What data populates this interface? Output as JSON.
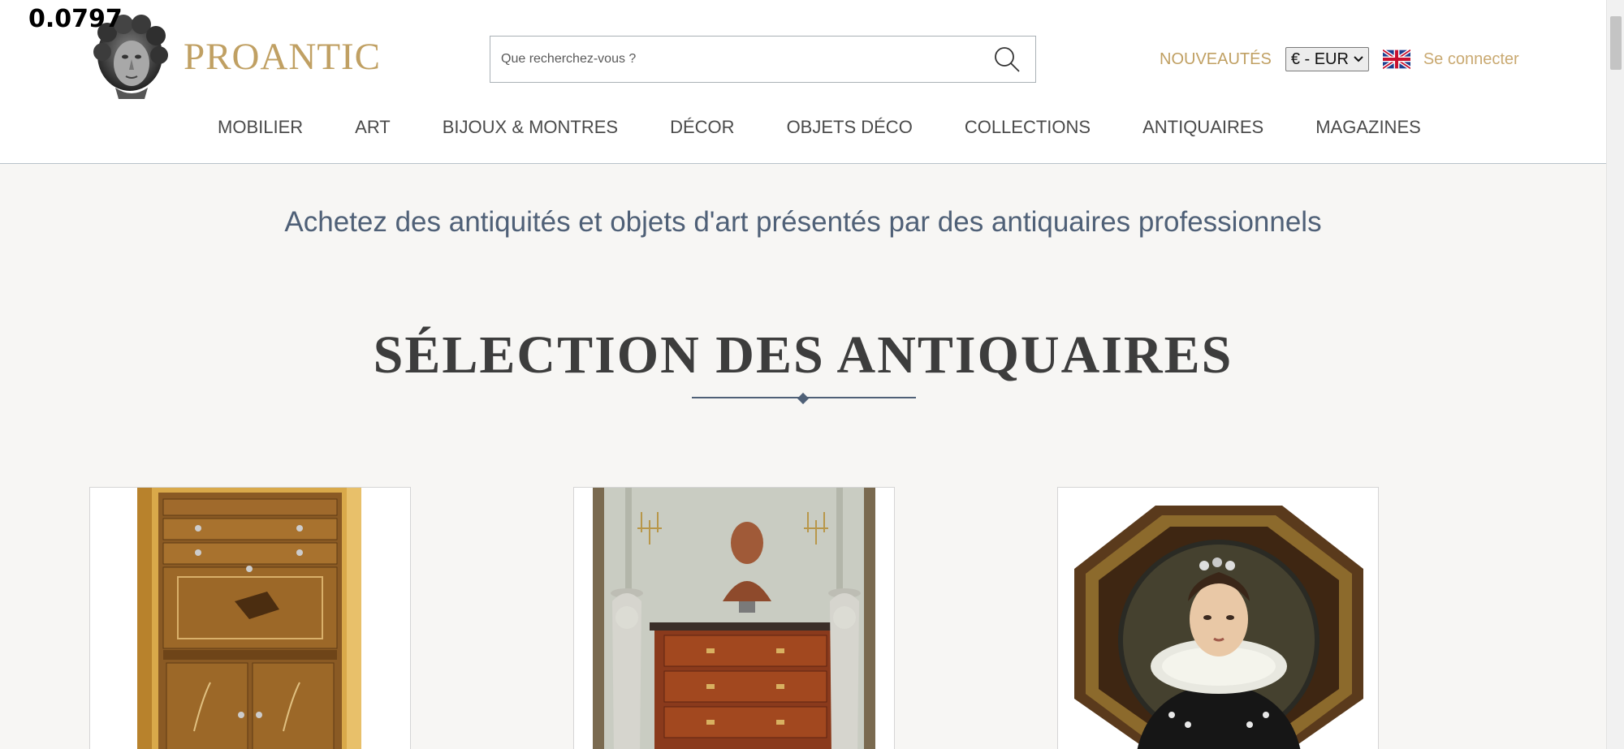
{
  "overlay": {
    "value": "0.0797"
  },
  "header": {
    "logo_text": "PROANTIC",
    "search": {
      "placeholder": "Que recherchez-vous ?",
      "value": ""
    },
    "nouveautes_label": "NOUVEAUTÉS",
    "currency": {
      "selected": "€ - EUR"
    },
    "language_flag": "uk-flag-icon",
    "login_label": "Se connecter"
  },
  "nav": {
    "items": [
      {
        "label": "MOBILIER"
      },
      {
        "label": "ART"
      },
      {
        "label": "BIJOUX & MONTRES"
      },
      {
        "label": "DÉCOR"
      },
      {
        "label": "OBJETS DÉCO"
      },
      {
        "label": "COLLECTIONS"
      },
      {
        "label": "ANTIQUAIRES"
      },
      {
        "label": "MAGAZINES"
      }
    ]
  },
  "main": {
    "tagline": "Achetez des antiquités et objets d'art présentés par des antiquaires professionnels",
    "section_title": "SÉLECTION DES ANTIQUAIRES"
  },
  "colors": {
    "gold": "#c0a063",
    "slate_blue": "#4f6077",
    "page_bg": "#f7f6f4"
  }
}
